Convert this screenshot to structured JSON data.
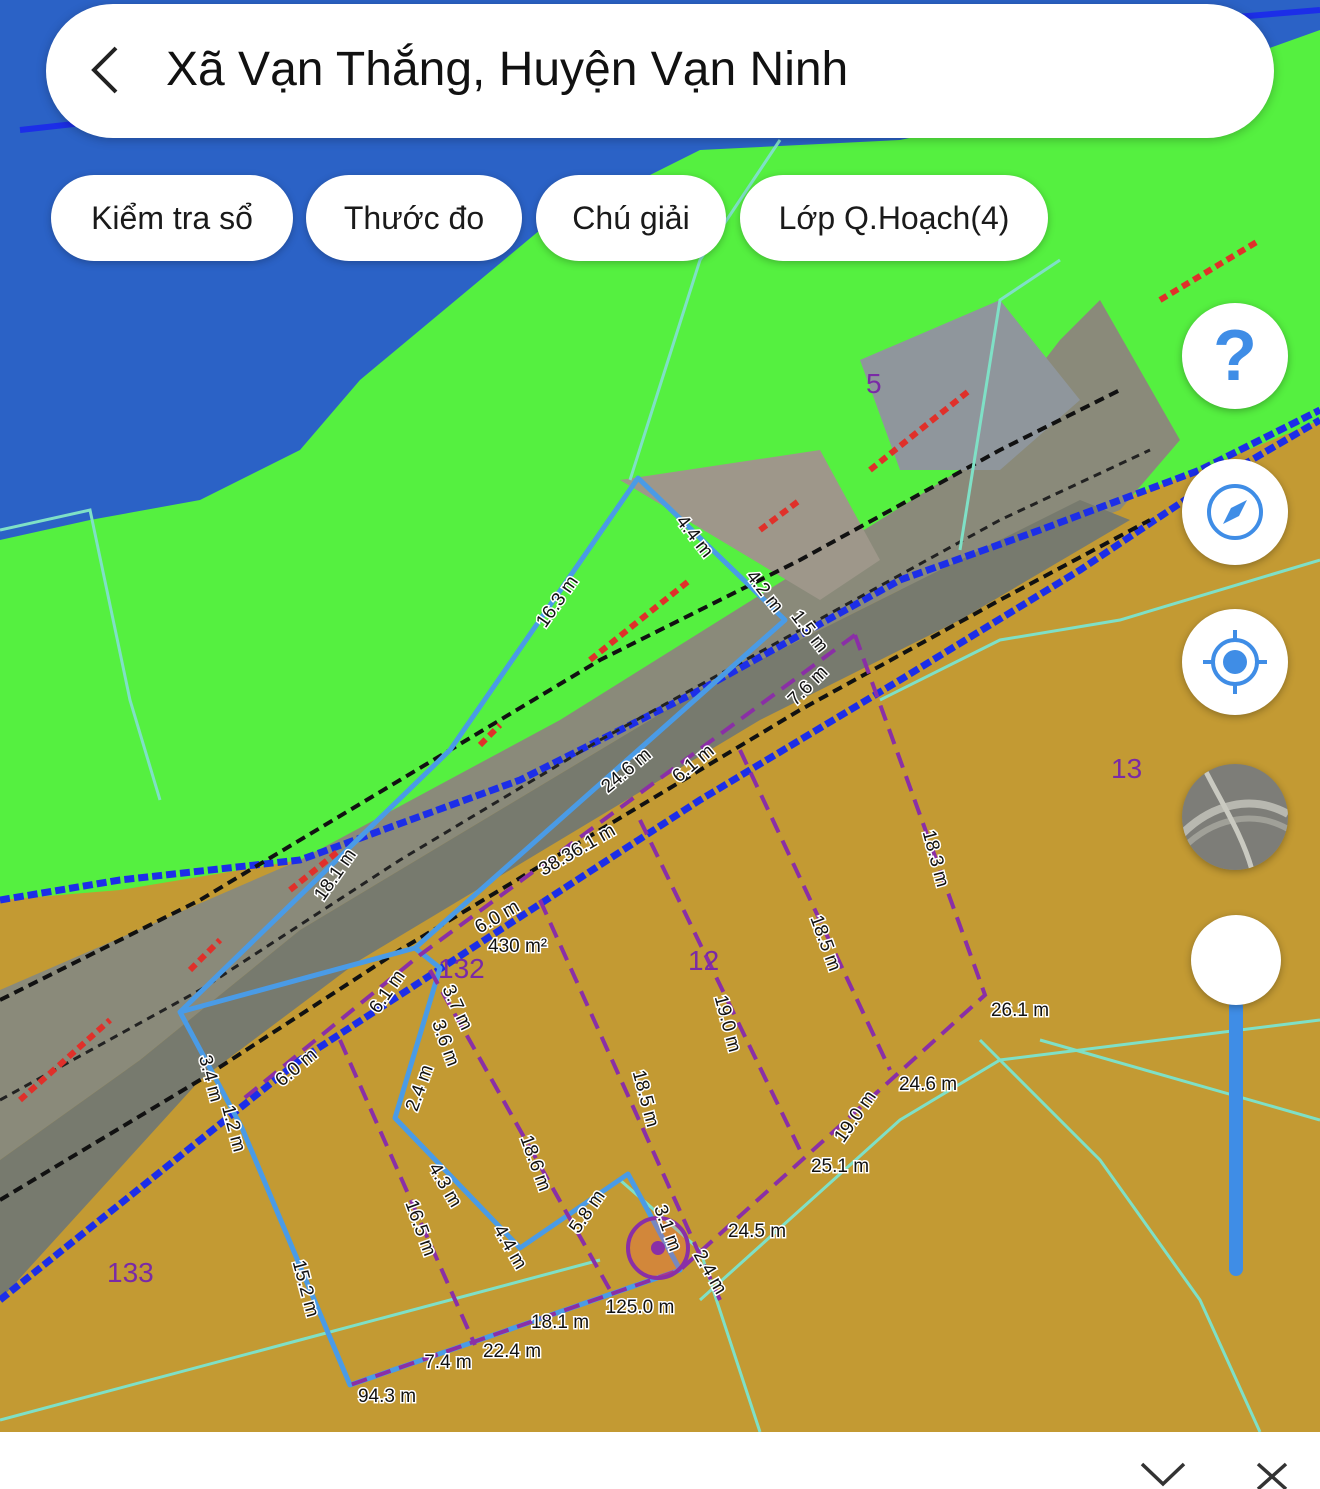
{
  "header": {
    "title": "Xã Vạn Thắng, Huyện Vạn Ninh"
  },
  "chips": [
    {
      "label": "Kiểm tra sổ"
    },
    {
      "label": "Thước đo"
    },
    {
      "label": "Chú giải"
    },
    {
      "label": "Lớp Q.Hoạch(4)"
    }
  ],
  "controls": {
    "help_glyph": "?",
    "icons": [
      "help-icon",
      "compass-icon",
      "locate-icon",
      "layer-thumbnail",
      "zoom-slider"
    ]
  },
  "colors": {
    "water": "#2b62c6",
    "green_zone": "#55f040",
    "farmland": "#c39a33",
    "parcel_outline": "#4a9be6",
    "planning_dashed": "#8a2fa6",
    "boundary": "#1c2ee8",
    "parcel_number": "#7a2aa6"
  },
  "map": {
    "parcel_numbers": [
      "5",
      "13",
      "12",
      "132",
      "133"
    ],
    "area_label": "430 m²",
    "measurements": [
      "4.4 m",
      "4.2 m",
      "1.5 m",
      "16.3 m",
      "7.6 m",
      "24.6 m",
      "6.1 m",
      "38.36.1 m",
      "18.3 m",
      "6.0 m",
      "18.1 m",
      "18.5 m",
      "19.0 m",
      "6.1 m",
      "3.7 m",
      "3.6 m",
      "26.1 m",
      "6.0 m",
      "2.4 m",
      "24.6 m",
      "3.4 m",
      "1.2 m",
      "18.5 m",
      "19.0 m",
      "18.6 m",
      "4.3 m",
      "25.1 m",
      "5.8 m",
      "16.5 m",
      "3.1 m",
      "24.5 m",
      "4.4 m",
      "2.4 m",
      "15.2 m",
      "125.0 m",
      "18.1 m",
      "22.4 m",
      "7.4 m",
      "94.3 m"
    ]
  }
}
